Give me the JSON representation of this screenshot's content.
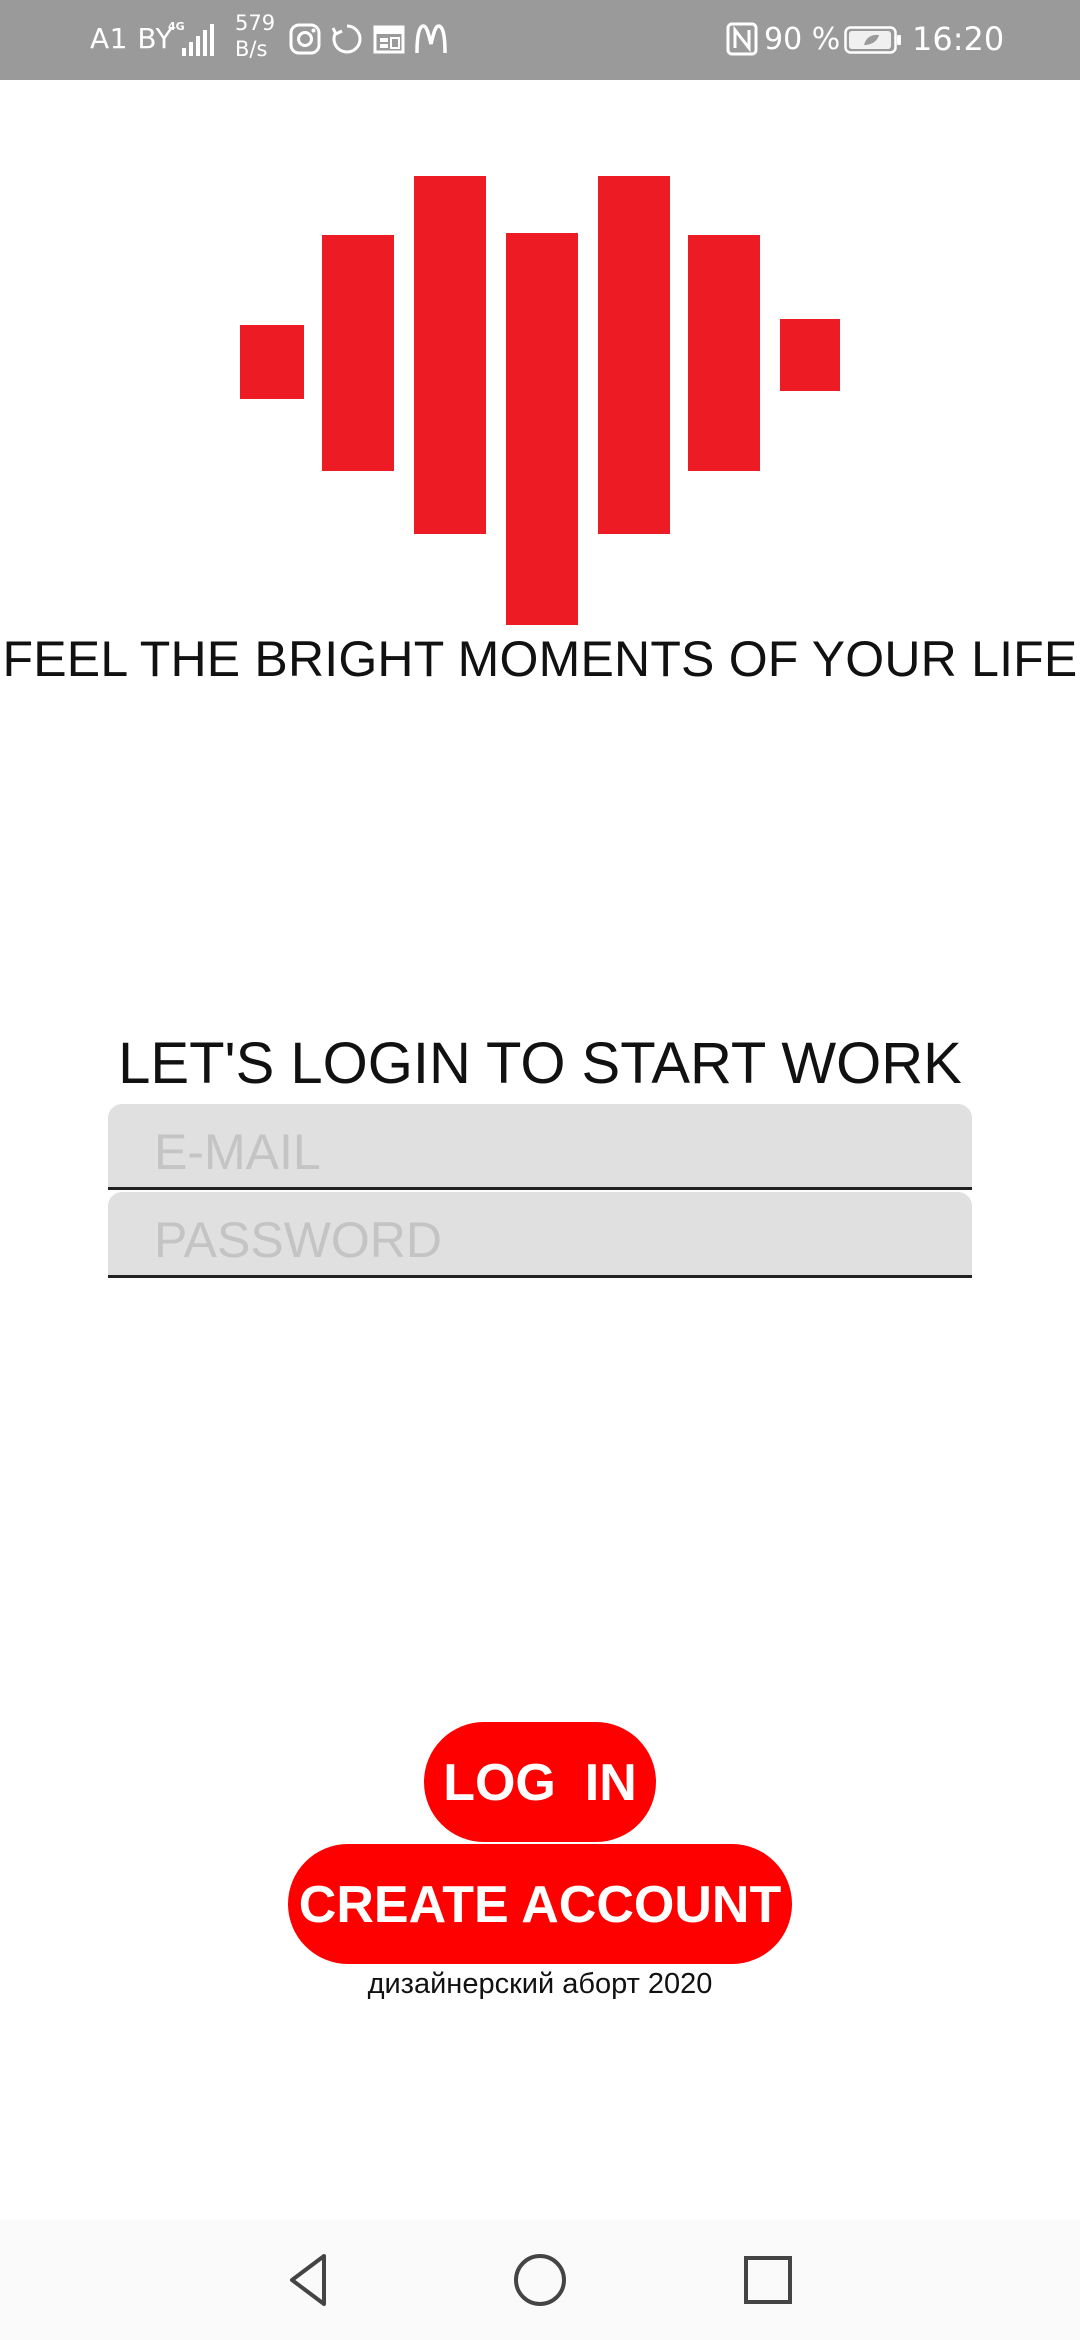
{
  "status_bar": {
    "carrier": "A1 BY",
    "network_type": "4G",
    "speed_value": "579",
    "speed_unit": "B/s",
    "battery": "90 %",
    "time": "16:20",
    "icons": [
      "signal-icon",
      "instagram-icon",
      "sync-icon",
      "calendar-icon",
      "mcdonalds-icon",
      "nfc-icon",
      "battery-icon"
    ]
  },
  "logo": {
    "name": "heartbeat-bars-logo",
    "color": "#ed1c24"
  },
  "tagline": "FEEL THE BRIGHT MOMENTS OF YOUR LIFE",
  "login": {
    "heading": "LET'S LOGIN TO START WORK",
    "email_placeholder": "E-MAIL",
    "email_value": "",
    "password_placeholder": "PASSWORD",
    "password_value": ""
  },
  "buttons": {
    "login_label": "LOG  IN",
    "create_label": "CREATE ACCOUNT",
    "color": "#ff0000"
  },
  "footer": {
    "credit": "дизайнерский аборт 2020"
  },
  "nav_bar": {
    "icons": [
      "back-icon",
      "home-icon",
      "recents-icon"
    ]
  }
}
